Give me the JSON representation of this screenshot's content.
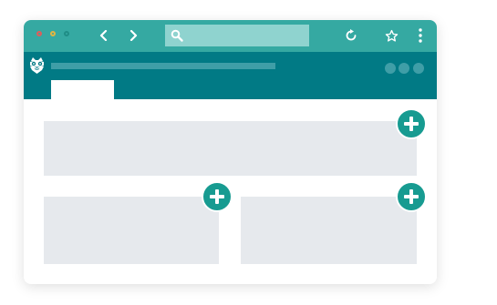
{
  "browser": {
    "window_controls": [
      "close-dot",
      "minimize-dot",
      "maximize-dot"
    ],
    "nav": {
      "back_icon": "chevron-left-icon",
      "forward_icon": "chevron-right-icon"
    },
    "address_bar": {
      "value": "",
      "icon": "search-icon"
    },
    "toolbar": {
      "reload_icon": "reload-icon",
      "bookmark_icon": "star-icon",
      "menu_icon": "kebab-menu-icon"
    }
  },
  "app_header": {
    "logo_icon": "owl-logo-icon",
    "title": "",
    "actions": [
      "header-action-1",
      "header-action-2",
      "header-action-3"
    ],
    "active_tab_label": ""
  },
  "content": {
    "cards": [
      {
        "name": "card-top",
        "add_icon": "plus-icon"
      },
      {
        "name": "card-bottom-left",
        "add_icon": "plus-icon"
      },
      {
        "name": "card-bottom-right",
        "add_icon": "plus-icon"
      }
    ]
  },
  "colors": {
    "chrome": "#35a9a2",
    "header": "#017a85",
    "card": "#e6e9ed",
    "add_button": "#179b91"
  }
}
